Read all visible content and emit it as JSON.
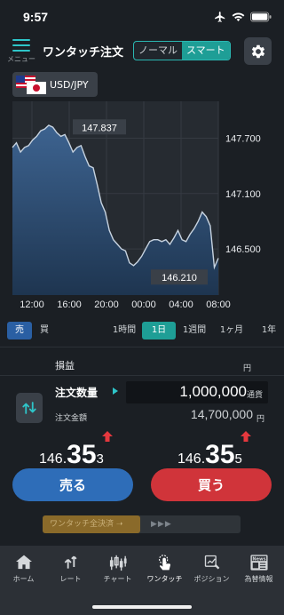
{
  "status_bar": {
    "time": "9:57"
  },
  "header": {
    "menu_label": "メニュー",
    "title": "ワンタッチ注文",
    "mode_normal": "ノーマル",
    "mode_smart": "スマート"
  },
  "pair": {
    "label": "USD/JPY"
  },
  "chart_data": {
    "type": "area",
    "x_ticks": [
      "12:00",
      "16:00",
      "20:00",
      "00:00",
      "04:00",
      "08:00"
    ],
    "y_ticks": [
      "147.700",
      "147.100",
      "146.500"
    ],
    "high_label": "147.837",
    "low_label": "146.210",
    "ylim": [
      146.0,
      148.1
    ],
    "values": [
      147.6,
      147.65,
      147.55,
      147.6,
      147.62,
      147.68,
      147.72,
      147.78,
      147.8,
      147.84,
      147.82,
      147.76,
      147.72,
      147.74,
      147.65,
      147.55,
      147.6,
      147.62,
      147.5,
      147.4,
      147.38,
      147.2,
      147.0,
      146.9,
      146.7,
      146.6,
      146.55,
      146.5,
      146.48,
      146.35,
      146.32,
      146.36,
      146.42,
      146.5,
      146.58,
      146.6,
      146.6,
      146.58,
      146.6,
      146.55,
      146.62,
      146.7,
      146.6,
      146.58,
      146.66,
      146.72,
      146.8,
      146.9,
      146.85,
      146.75,
      146.3,
      146.4
    ]
  },
  "side_tabs": [
    "売",
    "買"
  ],
  "periods": [
    "1時間",
    "1日",
    "1週間",
    "1ヶ月",
    "1年"
  ],
  "order": {
    "pl_label": "損益",
    "pl_unit": "円",
    "qty_label": "注文数量",
    "qty_value": "1,000,000",
    "qty_unit": "通貨",
    "amount_label": "注文金額",
    "amount_value": "14,700,000",
    "amount_unit": "円"
  },
  "prices": {
    "bid": {
      "pre": "146.",
      "big": "35",
      "post": "3"
    },
    "ask": {
      "pre": "146.",
      "big": "35",
      "post": "5"
    }
  },
  "buttons": {
    "sell": "売る",
    "buy": "買う"
  },
  "settle": {
    "label": "ワンタッチ全決済 ➝",
    "chevrons": "▶▶▶"
  },
  "nav": {
    "home": "ホーム",
    "rate": "レート",
    "chart": "チャート",
    "onetouch": "ワンタッチ",
    "position": "ポジション",
    "news": "為替情報",
    "news_badge": "News"
  },
  "colors": {
    "accent": "#2ec5c9",
    "sell": "#2e6db8",
    "buy": "#d0343a",
    "up_arrow": "#e5383e",
    "line": "#c7d3e0"
  }
}
